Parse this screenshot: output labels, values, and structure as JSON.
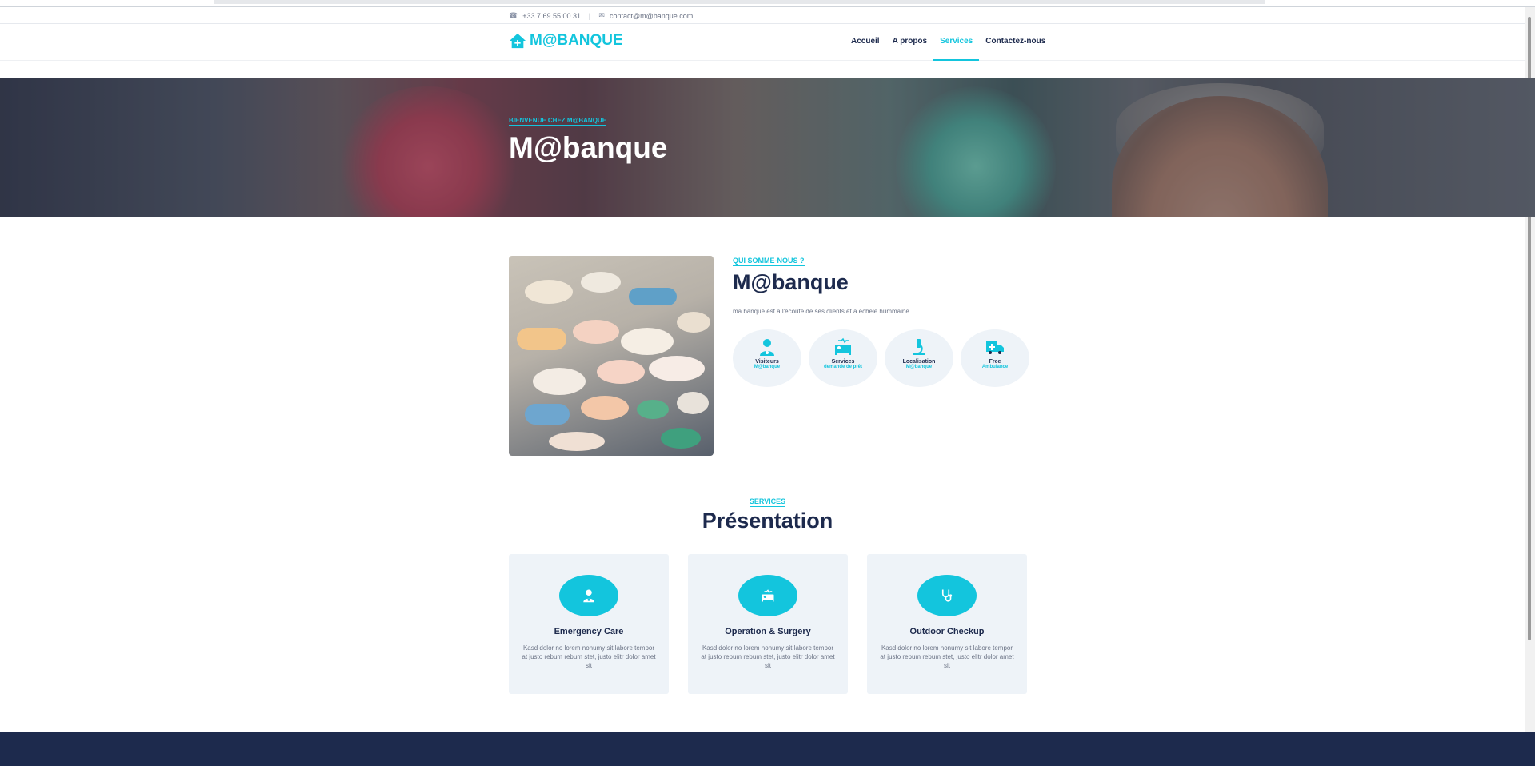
{
  "topbar": {
    "phone": "+33 7 69 55 00 31",
    "separator": "|",
    "email": "contact@m@banque.com"
  },
  "navbar": {
    "brand": "M@BANQUE",
    "links": [
      {
        "label": "Accueil",
        "active": false
      },
      {
        "label": "A propos",
        "active": false
      },
      {
        "label": "Services",
        "active": true
      },
      {
        "label": "Contactez-nous",
        "active": false
      }
    ]
  },
  "hero": {
    "eyebrow": "Bienvenue chez M@banque",
    "title": "M@banque"
  },
  "about": {
    "eyebrow": "Qui somme-nous ?",
    "title": "M@banque",
    "text": "ma banque est a l'écoute de ses clients et a echele hummaine.",
    "features": [
      {
        "icon": "user-doctor-icon",
        "title": "Visiteurs",
        "subtitle": "M@banque"
      },
      {
        "icon": "bed-icon",
        "title": "Services",
        "subtitle": "demande de prêt"
      },
      {
        "icon": "microscope-icon",
        "title": "Localisation",
        "subtitle": "M@banque"
      },
      {
        "icon": "ambulance-icon",
        "title": "Free",
        "subtitle": "Ambulance"
      }
    ]
  },
  "services": {
    "eyebrow": "Services",
    "title": "Présentation",
    "cards": [
      {
        "icon": "user-doctor-icon",
        "title": "Emergency Care",
        "text": "Kasd dolor no lorem nonumy sit labore tempor at justo rebum rebum stet, justo elitr dolor amet sit"
      },
      {
        "icon": "procedures-icon",
        "title": "Operation & Surgery",
        "text": "Kasd dolor no lorem nonumy sit labore tempor at justo rebum rebum stet, justo elitr dolor amet sit"
      },
      {
        "icon": "stethoscope-icon",
        "title": "Outdoor Checkup",
        "text": "Kasd dolor no lorem nonumy sit labore tempor at justo rebum rebum stet, justo elitr dolor amet sit"
      }
    ]
  },
  "colors": {
    "accent": "#13c5dd",
    "dark": "#1d2a4d",
    "light_bg": "#eef3f8"
  }
}
